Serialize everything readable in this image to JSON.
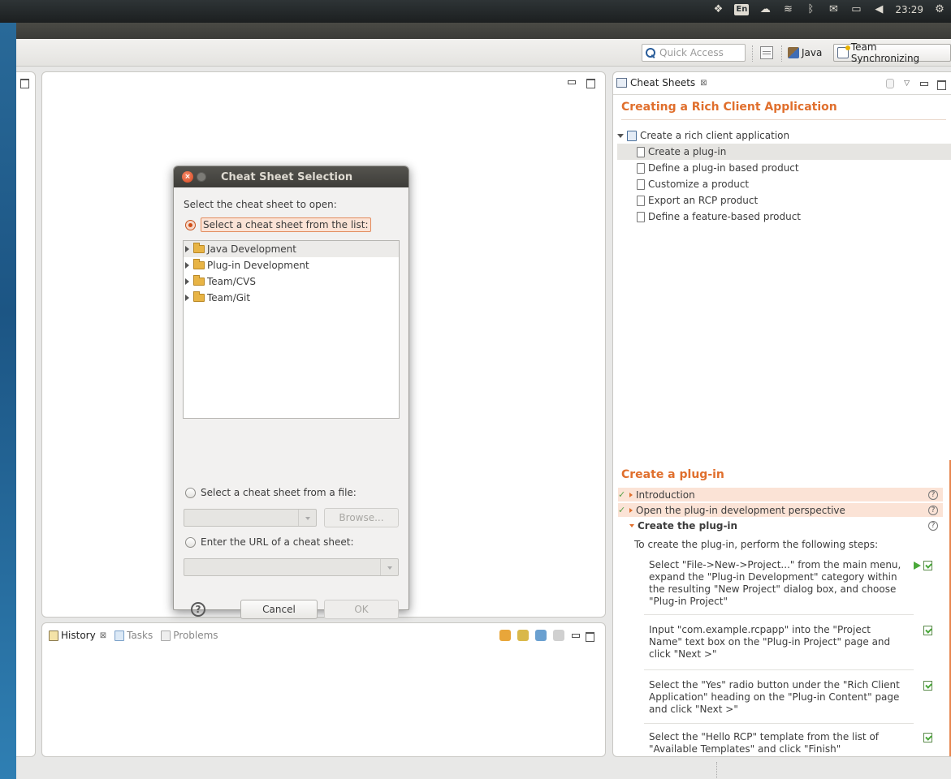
{
  "tray": {
    "keyboard_layout": "En",
    "clock": "23:29",
    "icons": [
      "dropbox-icon",
      "keyboard-icon",
      "cloud-icon",
      "wifi-icon",
      "bluetooth-icon",
      "mail-icon",
      "battery-icon",
      "volume-icon",
      "settings-gear-icon"
    ]
  },
  "toolbar": {
    "quick_access_placeholder": "Quick Access",
    "perspective_java": "Java",
    "perspective_team": "Team Synchronizing"
  },
  "bottom_panel": {
    "tabs": [
      {
        "label": "History",
        "active": true
      },
      {
        "label": "Tasks",
        "active": false
      },
      {
        "label": "Problems",
        "active": false
      }
    ],
    "close_glyph": "⊠"
  },
  "dialog": {
    "title": "Cheat Sheet Selection",
    "prompt": "Select the cheat sheet to open:",
    "option_list": "Select a cheat sheet from the list:",
    "tree_items": [
      "Java Development",
      "Plug-in Development",
      "Team/CVS",
      "Team/Git"
    ],
    "option_file": "Select a cheat sheet from a file:",
    "browse_label": "Browse...",
    "option_url": "Enter the URL of a cheat sheet:",
    "help_glyph": "?",
    "cancel_label": "Cancel",
    "ok_label": "OK"
  },
  "cheat_sheets": {
    "tab_label": "Cheat Sheets",
    "close_glyph": "⊠",
    "title": "Creating a Rich Client Application",
    "root_item": "Create a rich client application",
    "items": [
      "Create a plug-in",
      "Define a plug-in based product",
      "Customize a product",
      "Export an RCP product",
      "Define a feature-based product"
    ],
    "step_title": "Create a plug-in",
    "steps": [
      {
        "label": "Introduction",
        "done": true
      },
      {
        "label": "Open the plug-in development perspective",
        "done": true
      },
      {
        "label": "Create the plug-in",
        "done": false
      }
    ],
    "check_glyph": "✓",
    "help_glyph": "?",
    "intro": "To create the plug-in, perform the following steps:",
    "substeps": [
      "Select \"File->New->Project...\" from the main menu, expand the \"Plug-in Development\" category within the resulting \"New Project\" dialog box, and choose \"Plug-in Project\"",
      "Input \"com.example.rcpapp\" into the \"Project Name\" text box on the \"Plug-in Project\" page and click \"Next >\"",
      "Select the \"Yes\" radio button under the \"Rich Client Application\" heading on the \"Plug-in Content\" page and click \"Next >\"",
      "Select the \"Hello RCP\" template from the list of \"Available Templates\" and click \"Finish\""
    ]
  }
}
